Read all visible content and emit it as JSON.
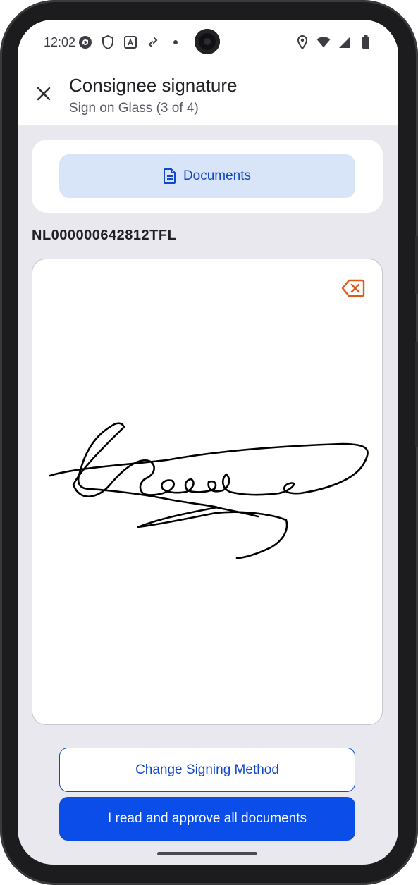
{
  "status_bar": {
    "time": "12:02",
    "left_icons": [
      "sync-icon",
      "shield-icon",
      "font-app-icon",
      "link-icon",
      "dot-icon"
    ],
    "right_icons": [
      "location-icon",
      "wifi-icon",
      "signal-icon",
      "battery-icon"
    ]
  },
  "app_bar": {
    "title": "Consignee signature",
    "subtitle": "Sign on Glass (3 of 4)"
  },
  "documents_button": {
    "label": "Documents",
    "icon": "document-icon"
  },
  "shipment": {
    "id": "NL000000642812TFL"
  },
  "signature_pad": {
    "clear_icon": "backspace-clear-icon",
    "accent_color": "#e05a16"
  },
  "actions": {
    "change_method_label": "Change Signing Method",
    "approve_label": "I read and approve all documents"
  },
  "colors": {
    "primary": "#0a4de8",
    "primary_text": "#1147c9",
    "doc_button_bg": "#d8e4f8",
    "background": "#e8e8ee"
  }
}
